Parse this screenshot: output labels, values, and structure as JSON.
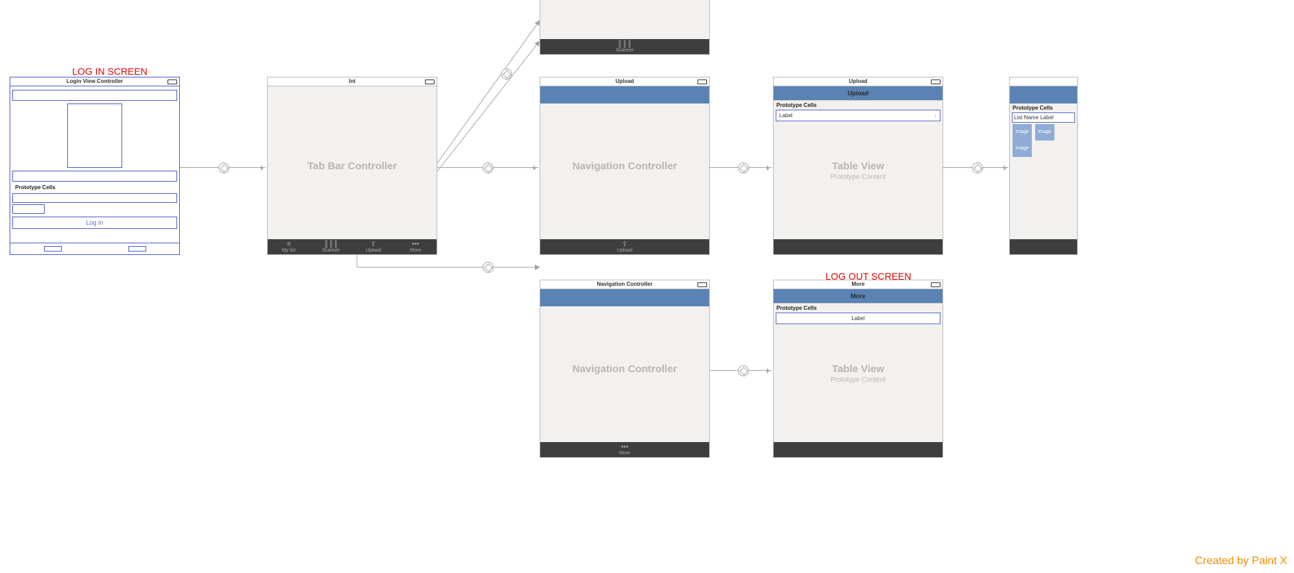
{
  "annotations": {
    "login": "LOG IN SCREEN",
    "logout": "LOG OUT SCREEN"
  },
  "watermark": "Created by Paint X",
  "screens": {
    "login": {
      "title": "Login View Controller",
      "prototypeCells": "Prototype Cells",
      "button": "Log In"
    },
    "tabbar": {
      "title": "Int",
      "label": "Tab Bar Controller",
      "tabs": [
        "My list",
        "Scanner",
        "Upload",
        "More"
      ]
    },
    "scanner_fragment": {
      "tab": "Scanner"
    },
    "nav_upload": {
      "title": "Upload",
      "label": "Navigation Controller",
      "tab": "Upload"
    },
    "table_upload": {
      "title": "Upload",
      "navTitle": "Upload",
      "prototypeCells": "Prototype Cells",
      "cellLabel": "Label",
      "mainLabel": "Table View",
      "mainSub": "Prototype Content"
    },
    "collection": {
      "prototypeCells": "Prototype Cells",
      "cellLabel": "List Name Label",
      "chip": "Image"
    },
    "nav_more": {
      "title": "Navigation Controller",
      "label": "Navigation Controller",
      "tab": "More"
    },
    "table_more": {
      "title": "More",
      "navTitle": "More",
      "prototypeCells": "Prototype Cells",
      "cellLabel": "Label",
      "mainLabel": "Table View",
      "mainSub": "Prototype Content"
    }
  }
}
